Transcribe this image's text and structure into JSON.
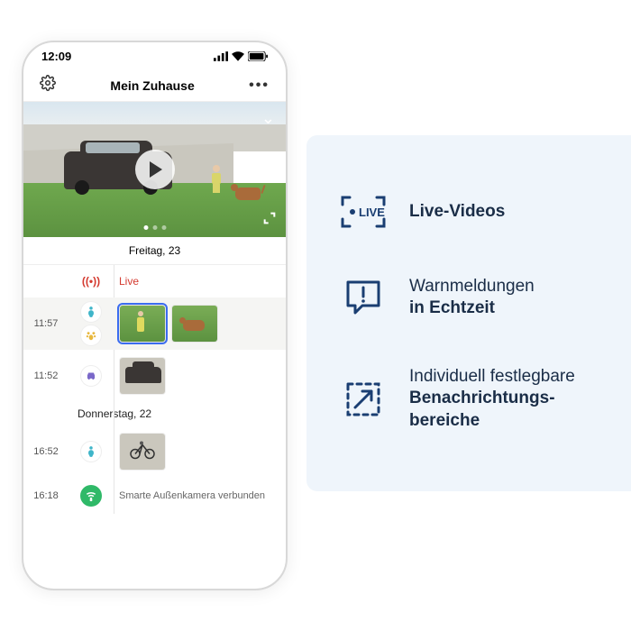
{
  "status_bar": {
    "time": "12:09"
  },
  "header": {
    "title": "Mein Zuhause"
  },
  "preview": {
    "date_label": "Freitag, 23"
  },
  "timeline": {
    "live_label": "Live",
    "rows": [
      {
        "time": "11:57"
      },
      {
        "time": "11:52"
      },
      {
        "time": "16:52"
      },
      {
        "time": "16:18",
        "status": "Smarte Außenkamera verbunden"
      }
    ],
    "separator": "Donnerstag, 22"
  },
  "features": [
    {
      "title_bold": "Live-Videos",
      "title_plain": ""
    },
    {
      "title_plain": "Warnmeldungen",
      "title_bold": "in Echtzeit"
    },
    {
      "title_plain": "Individuell festlegbare",
      "title_bold": "Benachrichtungs­bereiche"
    }
  ],
  "colors": {
    "accent": "#1a3e72",
    "live": "#d43a2f"
  }
}
